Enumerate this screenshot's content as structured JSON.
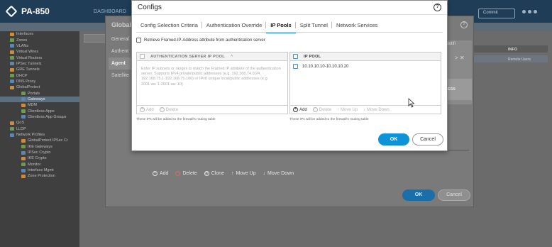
{
  "app": {
    "logo_text": "PA-850",
    "nav_dashboard": "DASHBOARD",
    "commit_label": "Commit",
    "sidebar": [
      {
        "label": "Interfaces",
        "level": 1,
        "icon": "interface-icon"
      },
      {
        "label": "Zones",
        "level": 1,
        "icon": "zone-icon"
      },
      {
        "label": "VLANs",
        "level": 1,
        "icon": "vlan-icon"
      },
      {
        "label": "Virtual Wires",
        "level": 1,
        "icon": "virtual-wire-icon"
      },
      {
        "label": "Virtual Routers",
        "level": 1,
        "icon": "router-icon"
      },
      {
        "label": "IPSec Tunnels",
        "level": 1,
        "icon": "tunnel-icon"
      },
      {
        "label": "GRE Tunnels",
        "level": 1,
        "icon": "tunnel-icon"
      },
      {
        "label": "DHCP",
        "level": 1,
        "icon": "dhcp-icon"
      },
      {
        "label": "DNS Proxy",
        "level": 1,
        "icon": "dns-icon"
      },
      {
        "label": "GlobalProtect",
        "level": 1,
        "icon": "globe-icon"
      },
      {
        "label": "Portals",
        "level": 2,
        "icon": "portal-icon"
      },
      {
        "label": "Gateways",
        "level": 2,
        "icon": "gateway-icon",
        "selected": true
      },
      {
        "label": "MDM",
        "level": 2,
        "icon": "mdm-icon"
      },
      {
        "label": "Clientless Apps",
        "level": 2,
        "icon": "app-icon"
      },
      {
        "label": "Clientless App Groups",
        "level": 2,
        "icon": "app-group-icon"
      },
      {
        "label": "QoS",
        "level": 1,
        "icon": "qos-icon"
      },
      {
        "label": "LLDP",
        "level": 1,
        "icon": "lldp-icon"
      },
      {
        "label": "Network Profiles",
        "level": 1,
        "icon": "profile-icon"
      },
      {
        "label": "GlobalProtect IPSec Cr",
        "level": 2,
        "icon": "crypto-icon"
      },
      {
        "label": "IKE Gateways",
        "level": 2,
        "icon": "gateway-icon"
      },
      {
        "label": "IPSec Crypto",
        "level": 2,
        "icon": "crypto-icon"
      },
      {
        "label": "IKE Crypto",
        "level": 2,
        "icon": "crypto-icon"
      },
      {
        "label": "Monitor",
        "level": 2,
        "icon": "monitor-icon"
      },
      {
        "label": "Interface Mgmt",
        "level": 2,
        "icon": "interface-mgmt-icon"
      },
      {
        "label": "Zone Protection",
        "level": 2,
        "icon": "zone-protection-icon"
      }
    ],
    "table_info_header": "INFO",
    "table_info_value": "Remote Users"
  },
  "gateway_dialog": {
    "title": "Global",
    "help_icon": "help-icon",
    "nav": [
      "General",
      "Authent",
      "Agent",
      "Satellite"
    ],
    "active_nav": "Agent",
    "right_header": "IP Notifi",
    "right_col": "CCESS",
    "toolbar": {
      "add": "Add",
      "delete": "Delete",
      "clone": "Clone",
      "move_up": "Move Up",
      "move_down": "Move Down"
    },
    "ok_label": "OK",
    "cancel_label": "Cancel"
  },
  "configs_dialog": {
    "title": "Configs",
    "help_icon": "help-icon",
    "tabs": [
      {
        "label": "Config Selection Criteria",
        "active": false
      },
      {
        "label": "Authentication Override",
        "active": false
      },
      {
        "label": "IP Pools",
        "active": true
      },
      {
        "label": "Split Tunnel",
        "active": false
      },
      {
        "label": "Network Services",
        "active": false
      }
    ],
    "retrieve_label": "Retrieve Framed-IP-Address attribute from authentication server",
    "retrieve_checked": false,
    "auth_pool": {
      "header": "AUTHENTICATION SERVER IP POOL",
      "sort_icon": "caret-up-icon",
      "placeholder": "Enter IP subnets or ranges to match the Framed IP attribute of the authentication server. Supports IPv4 private/public addresses (e.g. 192.168.74.0/24, 192.168.75.1-192.168.75.100) or IPv6 unique local/public addresses (e.g. 2001:aa::1-2001:aa::10)",
      "add_label": "Add",
      "delete_label": "Delete",
      "note": "These IPs will be added to the firewall's routing table"
    },
    "ip_pool": {
      "header": "IP POOL",
      "rows": [
        "10.10.10.10-10.10.10.20"
      ],
      "add_label": "Add",
      "delete_label": "Delete",
      "move_up_label": "Move Up",
      "move_down_label": "Move Down",
      "note": "These IPs will be added to the firewall's routing table"
    },
    "ok_label": "OK",
    "cancel_label": "Cancel"
  }
}
